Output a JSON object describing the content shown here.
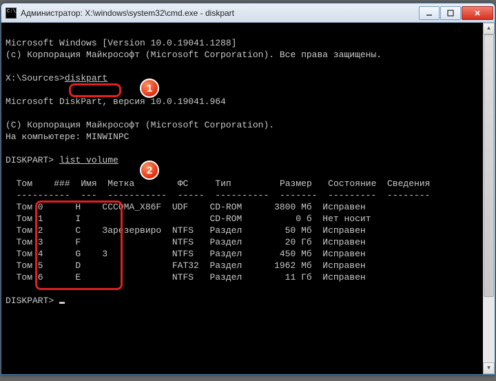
{
  "titlebar": {
    "title": "Администратор: X:\\windows\\system32\\cmd.exe - diskpart"
  },
  "console": {
    "line1": "Microsoft Windows [Version 10.0.19041.1288]",
    "line2": "(c) Корпорация Майкрософт (Microsoft Corporation). Все права защищены.",
    "prompt1_path": "X:\\Sources>",
    "prompt1_cmd": "diskpart",
    "diskpart_version": "Microsoft DiskPart, версия 10.0.19041.964",
    "copyright": "(C) Корпорация Майкрософт (Microsoft Corporation).",
    "computer_line": "На компьютере: MINWINPC",
    "prompt2_label": "DISKPART> ",
    "prompt2_cmd": "list volume",
    "table": {
      "headers": {
        "tom": "Том",
        "num": "###",
        "name": "Имя",
        "label": "Метка",
        "fs": "ФС",
        "type": "Тип",
        "size": "Размер",
        "status": "Состояние",
        "info": "Сведения"
      },
      "rows": [
        {
          "tom": "Том 0",
          "name": "H",
          "label": "CCCOMA_X86F",
          "fs": "UDF",
          "type": "CD-ROM",
          "size": "3800 Мб",
          "status": "Исправен"
        },
        {
          "tom": "Том 1",
          "name": "I",
          "label": "",
          "fs": "",
          "type": "CD-ROM",
          "size": "0 б",
          "status": "Нет носит"
        },
        {
          "tom": "Том 2",
          "name": "C",
          "label": "Зарезервиро",
          "fs": "NTFS",
          "type": "Раздел",
          "size": "50 Мб",
          "status": "Исправен"
        },
        {
          "tom": "Том 3",
          "name": "F",
          "label": "",
          "fs": "NTFS",
          "type": "Раздел",
          "size": "20 Гб",
          "status": "Исправен"
        },
        {
          "tom": "Том 4",
          "name": "G",
          "label": "3",
          "fs": "NTFS",
          "type": "Раздел",
          "size": "450 Мб",
          "status": "Исправен"
        },
        {
          "tom": "Том 5",
          "name": "D",
          "label": "",
          "fs": "FAT32",
          "type": "Раздел",
          "size": "1962 Мб",
          "status": "Исправен"
        },
        {
          "tom": "Том 6",
          "name": "E",
          "label": "",
          "fs": "NTFS",
          "type": "Раздел",
          "size": "11 Гб",
          "status": "Исправен"
        }
      ]
    },
    "prompt3_label": "DISKPART> "
  },
  "annotations": {
    "badge1": "1",
    "badge2": "2"
  }
}
